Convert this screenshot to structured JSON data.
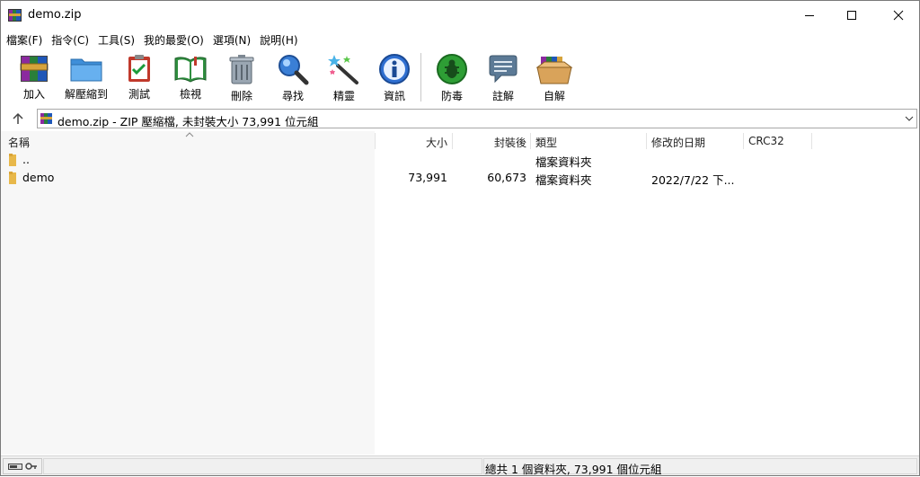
{
  "window": {
    "title": "demo.zip"
  },
  "menu": [
    "檔案(F)",
    "指令(C)",
    "工具(S)",
    "我的最愛(O)",
    "選項(N)",
    "說明(H)"
  ],
  "toolbar": {
    "add": "加入",
    "extract": "解壓縮到",
    "test": "測試",
    "view": "檢視",
    "delete": "刪除",
    "find": "尋找",
    "wizard": "精靈",
    "info": "資訊",
    "virus": "防毒",
    "comment": "註解",
    "sfx": "自解"
  },
  "address": {
    "text": "demo.zip - ZIP 壓縮檔, 未封裝大小 73,991 位元組"
  },
  "columns": {
    "name": "名稱",
    "size": "大小",
    "packed": "封裝後",
    "type": "類型",
    "modified": "修改的日期",
    "crc": "CRC32"
  },
  "rows": [
    {
      "name": "..",
      "size": "",
      "packed": "",
      "type": "檔案資料夾",
      "modified": "",
      "crc": ""
    },
    {
      "name": "demo",
      "size": "73,991",
      "packed": "60,673",
      "type": "檔案資料夾",
      "modified": "2022/7/22 下...",
      "crc": ""
    }
  ],
  "status": {
    "summary": "總共 1 個資料夾, 73,991 個位元組"
  },
  "icons": {
    "app": "winrar-icon",
    "up": "up-arrow-icon",
    "status_left": "drive-key-icon"
  },
  "colors": {
    "accent": "#0078d7",
    "folder": "#e8b84a"
  }
}
